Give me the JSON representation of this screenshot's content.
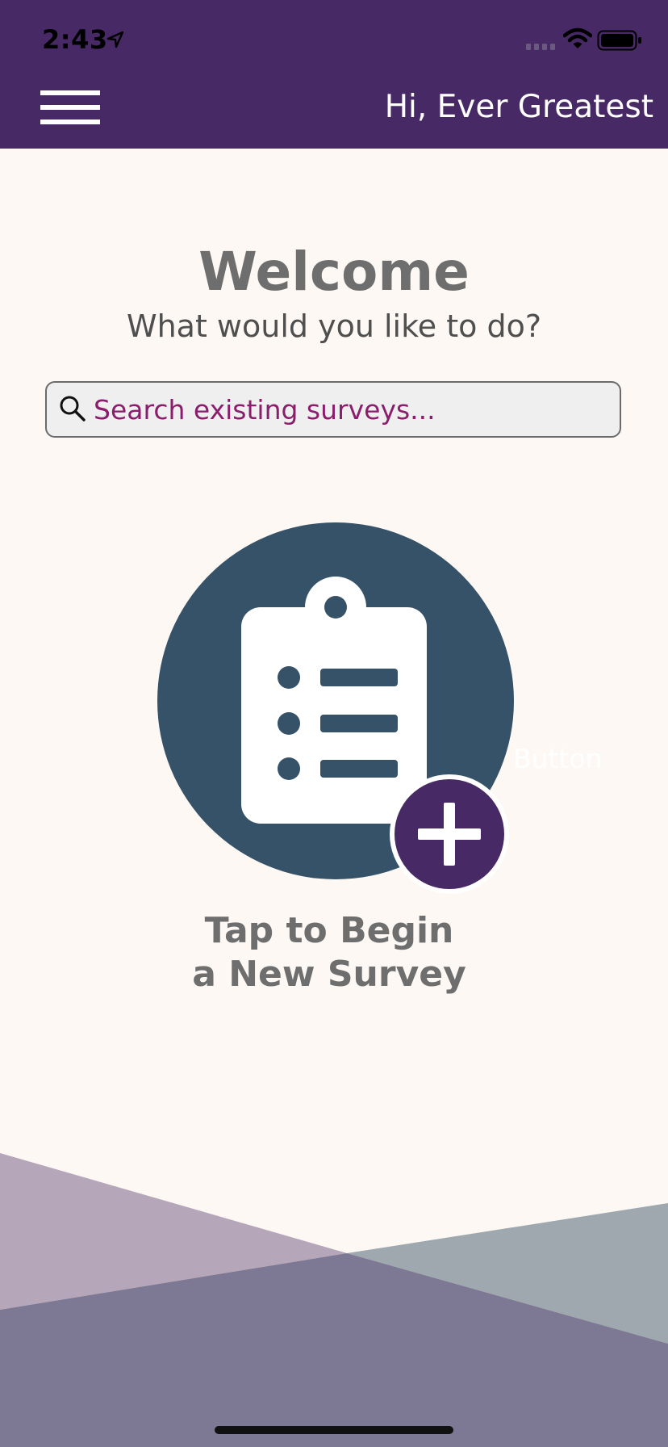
{
  "status_bar": {
    "time": "2:43",
    "icons": [
      "location-arrow-icon",
      "cellular-signal-icon",
      "wifi-icon",
      "battery-icon"
    ]
  },
  "header": {
    "menu_icon": "hamburger-menu-icon",
    "greeting": "Hi, Ever Greatest",
    "background": "#472966"
  },
  "main": {
    "title": "Welcome",
    "subtitle": "What would you like to do?",
    "search": {
      "placeholder": "Search existing surveys...",
      "value": "",
      "icon": "search-icon"
    },
    "new_survey": {
      "icon": "clipboard-list-icon",
      "badge_icon": "plus-icon",
      "ghost_label": "Button",
      "label_line1": "Tap to Begin",
      "label_line2": "a New Survey"
    }
  },
  "colors": {
    "accent_purple": "#472966",
    "circle_blue": "#355268",
    "search_text": "#8b1d6d",
    "background": "#fdf8f3"
  }
}
